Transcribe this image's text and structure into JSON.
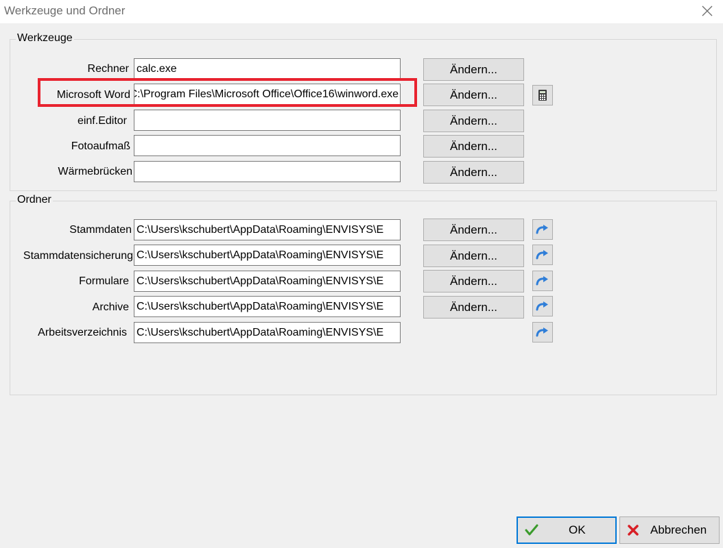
{
  "window": {
    "title": "Werkzeuge und Ordner"
  },
  "tools": {
    "group_label": "Werkzeuge",
    "rows": [
      {
        "label": "Rechner",
        "value": "calc.exe",
        "button": "Ändern..."
      },
      {
        "label": "Microsoft Word",
        "value": "C:\\Program Files\\Microsoft Office\\Office16\\winword.exe",
        "button": "Ändern...",
        "side_icon": "calculator-icon"
      },
      {
        "label": "einf.Editor",
        "value": "",
        "button": "Ändern..."
      },
      {
        "label": "Fotoaufmaß",
        "value": "",
        "button": "Ändern..."
      },
      {
        "label": "Wärmebrücken",
        "value": "",
        "button": "Ändern..."
      }
    ]
  },
  "folders": {
    "group_label": "Ordner",
    "rows": [
      {
        "label": "Stammdaten",
        "value": "C:\\Users\\kschubert\\AppData\\Roaming\\ENVISYS\\E",
        "button": "Ändern...",
        "side_icon": "redo-arrow-icon"
      },
      {
        "label": "Stammdatensicherung",
        "value": "C:\\Users\\kschubert\\AppData\\Roaming\\ENVISYS\\E",
        "button": "Ändern...",
        "side_icon": "redo-arrow-icon"
      },
      {
        "label": "Formulare",
        "value": "C:\\Users\\kschubert\\AppData\\Roaming\\ENVISYS\\E",
        "button": "Ändern...",
        "side_icon": "redo-arrow-icon"
      },
      {
        "label": "Archive",
        "value": "C:\\Users\\kschubert\\AppData\\Roaming\\ENVISYS\\E",
        "button": "Ändern...",
        "side_icon": "redo-arrow-icon"
      },
      {
        "label": "Arbeitsverzeichnis",
        "value": "C:\\Users\\kschubert\\AppData\\Roaming\\ENVISYS\\E",
        "side_icon": "redo-arrow-icon"
      }
    ]
  },
  "footer": {
    "ok_label": "OK",
    "cancel_label": "Abbrechen"
  },
  "colors": {
    "highlight": "#e8232f",
    "ok_check": "#3a9b2b",
    "cancel_x": "#d81f26",
    "arrow_blue": "#2f7ed8"
  }
}
